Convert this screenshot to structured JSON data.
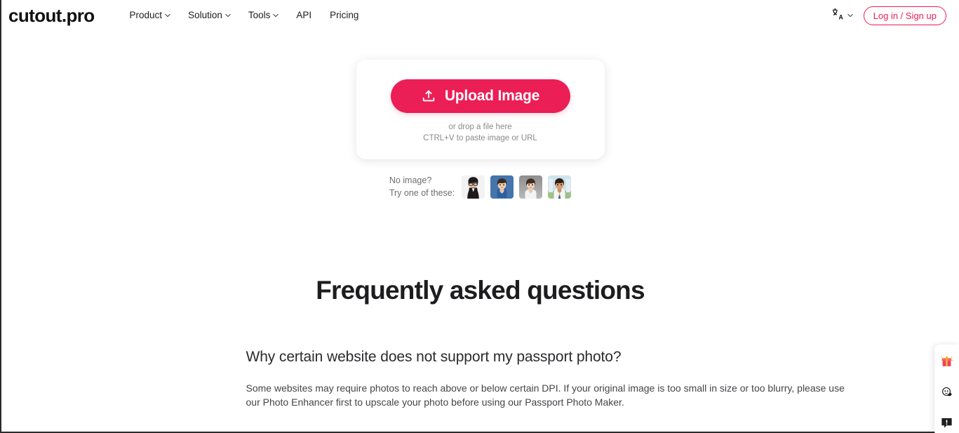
{
  "header": {
    "logo": "cutout.pro",
    "nav": [
      {
        "label": "Product",
        "has_caret": true
      },
      {
        "label": "Solution",
        "has_caret": true
      },
      {
        "label": "Tools",
        "has_caret": true
      },
      {
        "label": "API",
        "has_caret": false
      },
      {
        "label": "Pricing",
        "has_caret": false
      }
    ],
    "language_icon": "translate-icon",
    "login_label": "Log in / Sign up",
    "accent_color": "#eb1e55"
  },
  "upload": {
    "button_label": "Upload Image",
    "button_icon": "upload-icon",
    "drop_line1": "or drop a file here",
    "drop_line2": "CTRL+V to paste image or URL"
  },
  "samples": {
    "label_line1": "No image?",
    "label_line2": "Try one of these:",
    "thumbnails": [
      {
        "name": "sample-photo-1",
        "alt": "woman with glasses in black blazer on white background",
        "bg": "#f1f1f1"
      },
      {
        "name": "sample-photo-2",
        "alt": "child in blue denim shirt on blue background",
        "bg": "#3f6fa8"
      },
      {
        "name": "sample-photo-3",
        "alt": "child in white shirt on grey background",
        "bg": "#9a9a9a"
      },
      {
        "name": "sample-photo-4",
        "alt": "boy in white uniform with tie on outdoor background",
        "bg": "#cfe0ea"
      }
    ]
  },
  "faq": {
    "title": "Frequently asked questions",
    "items": [
      {
        "question": "Why certain website does not support my passport photo?",
        "answer": "Some websites may require photos to reach above or below certain DPI. If your original image is too small in size or too blurry, please use our Photo Enhancer first to upscale your photo before using our Passport Photo Maker."
      }
    ]
  },
  "widget": {
    "buttons": [
      {
        "name": "gift-icon",
        "title": "gift"
      },
      {
        "name": "discord-face-icon",
        "title": "community"
      },
      {
        "name": "feedback-bubble-icon",
        "title": "feedback"
      }
    ]
  }
}
